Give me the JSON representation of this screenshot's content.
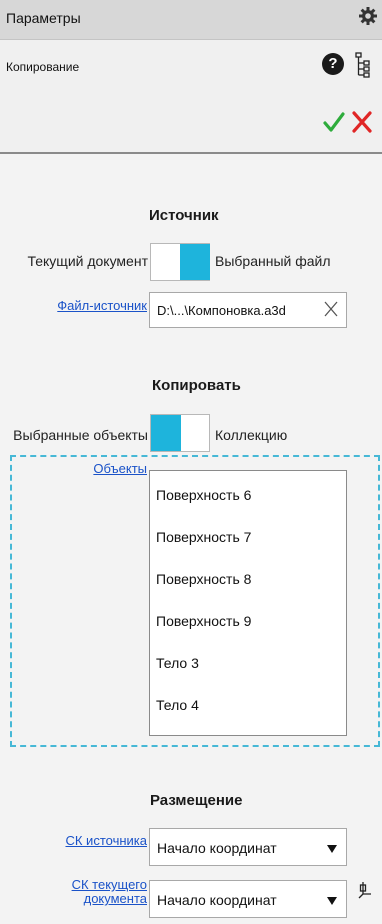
{
  "header": {
    "title": "Параметры",
    "settings_icon": "gear-icon"
  },
  "command": {
    "name": "Копирование",
    "help_icon": "question-circle-icon",
    "help_glyph": "?",
    "tree_icon": "tree-structure-icon",
    "ok_icon": "checkmark-icon",
    "cancel_icon": "x-icon",
    "ok_color": "#2eac3c",
    "cancel_color": "#e02626"
  },
  "source": {
    "title": "Источник",
    "toggle_left_label": "Текущий документ",
    "toggle_right_label": "Выбранный файл",
    "toggle_state": "right",
    "file_link": "Файл-источник",
    "file_value": "D:\\...\\Компоновка.a3d",
    "clear_icon": "x-icon"
  },
  "copy": {
    "title": "Копировать",
    "toggle_left_label": "Выбранные объекты",
    "toggle_right_label": "Коллекцию",
    "toggle_state": "left",
    "objects_link": "Объекты",
    "objects": [
      "Поверхность 6",
      "Поверхность 7",
      "Поверхность 8",
      "Поверхность 9",
      "Тело 3",
      "Тело 4"
    ]
  },
  "placement": {
    "title": "Размещение",
    "source_cs_link": "СК источника",
    "source_cs_value": "Начало координат",
    "current_cs_link_line1": "СК текущего",
    "current_cs_link_line2": "документа",
    "current_cs_value": "Начало координат",
    "pick_icon": "pick-point-icon"
  },
  "colors": {
    "accent": "#1eb4dc",
    "link": "#1a52c8",
    "dashed_border": "#46b8d6"
  }
}
